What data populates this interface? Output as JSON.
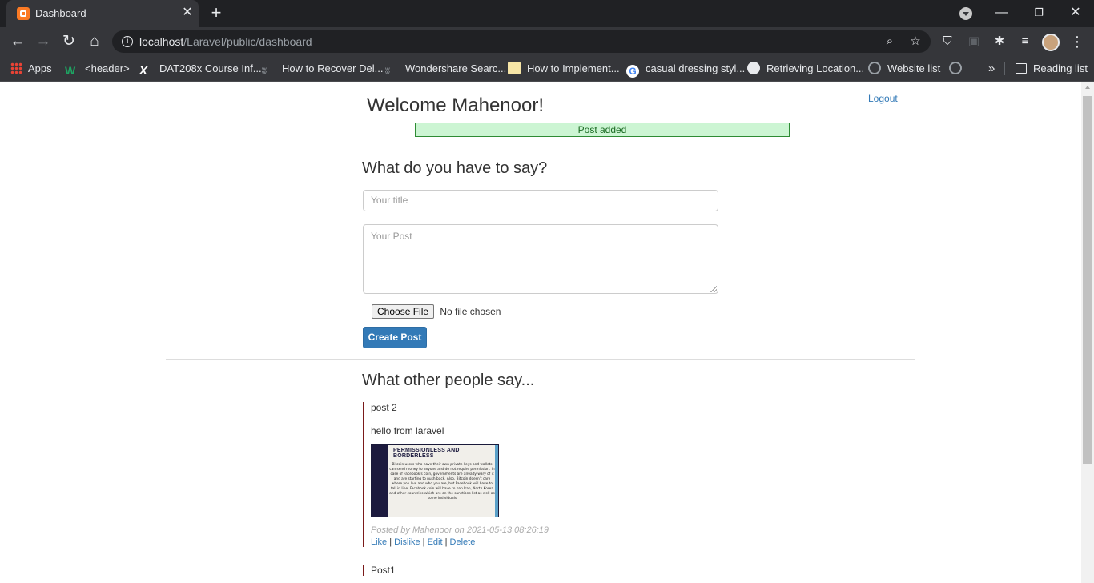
{
  "browser": {
    "tab_title": "Dashboard",
    "url_host": "localhost",
    "url_path": "/Laravel/public/dashboard",
    "bookmarks": [
      {
        "label": "Apps"
      },
      {
        "label": "<header>"
      },
      {
        "label": "DAT208x Course Inf..."
      },
      {
        "label": "How to Recover Del..."
      },
      {
        "label": "Wondershare Searc..."
      },
      {
        "label": "How to Implement..."
      },
      {
        "label": "casual dressing styl..."
      },
      {
        "label": "Retrieving Location..."
      },
      {
        "label": "Website list"
      }
    ],
    "reading_list": "Reading list"
  },
  "page": {
    "welcome": "Welcome Mahenoor!",
    "logout": "Logout",
    "flash": "Post added",
    "form": {
      "heading": "What do you have to say?",
      "title_placeholder": "Your title",
      "post_placeholder": "Your Post",
      "choose_file": "Choose File",
      "no_file": "No file chosen",
      "submit": "Create Post"
    },
    "feed_heading": "What other people say...",
    "posts": [
      {
        "title": "post 2",
        "body": "hello from laravel",
        "image_heading": "PERMISSIONLESS AND BORDERLESS",
        "image_text": "Bitcoin users who have their own private keys and wallets can send money to anyone and do not require permission. In case of Facebook's coin, governments are already wary of it and are starting to push back. Also, Bitcoin doesn't care where you live and who you are, but Facebook will have to fall in line. Facebook coin will have to ban Iran, North Korea and other countries which are on the sanctions list as well as some individuals",
        "meta": "Posted by Mahenoor on 2021-05-13 08:26:19",
        "actions": {
          "like": "Like",
          "dislike": "Dislike",
          "edit": "Edit",
          "delete": "Delete"
        }
      },
      {
        "title": "Post1"
      }
    ]
  }
}
